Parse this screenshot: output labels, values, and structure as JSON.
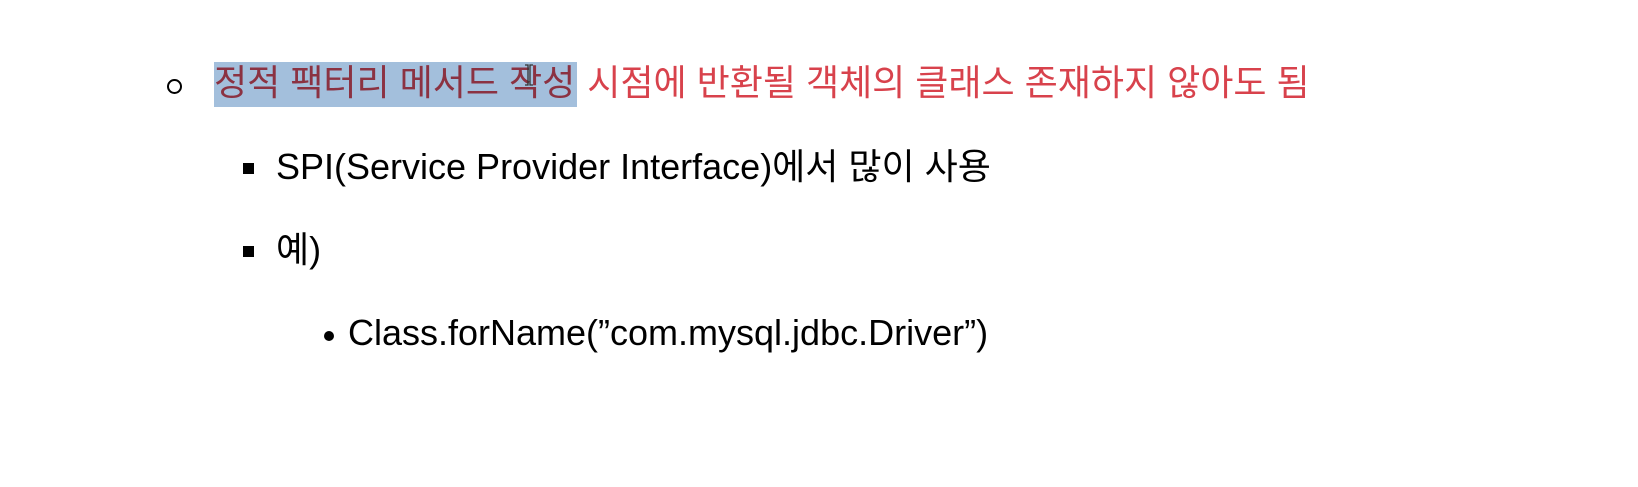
{
  "items": [
    {
      "level": 1,
      "highlighted": "정적 팩터리 메서드 작성",
      "rest": " 시점에 반환될 객체의 클래스 존재하지 않아도 됨"
    },
    {
      "level": 2,
      "text": "SPI(Service Provider Interface)에서 많이 사용"
    },
    {
      "level": 2,
      "text": "예)"
    },
    {
      "level": 3,
      "text": "Class.forName(”com.mysql.jdbc.Driver”)"
    }
  ],
  "colors": {
    "highlight": "#a3bfdc",
    "highlight_text": "#8b3242",
    "red_text": "#d8424c"
  }
}
